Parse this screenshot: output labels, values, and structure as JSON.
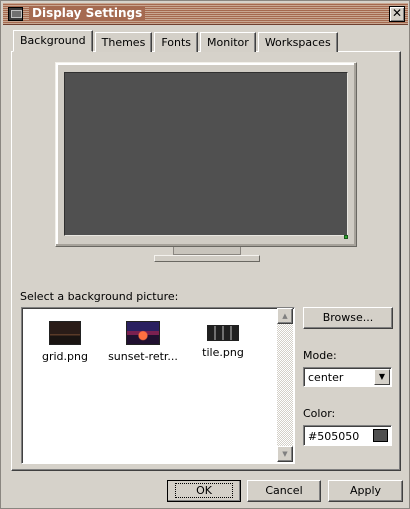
{
  "window": {
    "title": "Display Settings",
    "close_glyph": "✕"
  },
  "tabs": [
    {
      "label": "Background",
      "active": true
    },
    {
      "label": "Themes",
      "active": false
    },
    {
      "label": "Fonts",
      "active": false
    },
    {
      "label": "Monitor",
      "active": false
    },
    {
      "label": "Workspaces",
      "active": false
    }
  ],
  "preview": {
    "screen_color": "#505050"
  },
  "background": {
    "prompt": "Select a background picture:",
    "pictures": [
      {
        "label": "grid.png",
        "icon": "grid-thumbnail"
      },
      {
        "label": "sunset-retr...",
        "icon": "sunset-thumbnail"
      },
      {
        "label": "tile.png",
        "icon": "tile-thumbnail"
      }
    ],
    "browse_label": "Browse...",
    "mode_label": "Mode:",
    "mode_value": "center",
    "color_label": "Color:",
    "color_value": "#505050",
    "color_swatch": "#505050"
  },
  "footer": {
    "ok_label": "OK",
    "cancel_label": "Cancel",
    "apply_label": "Apply"
  }
}
